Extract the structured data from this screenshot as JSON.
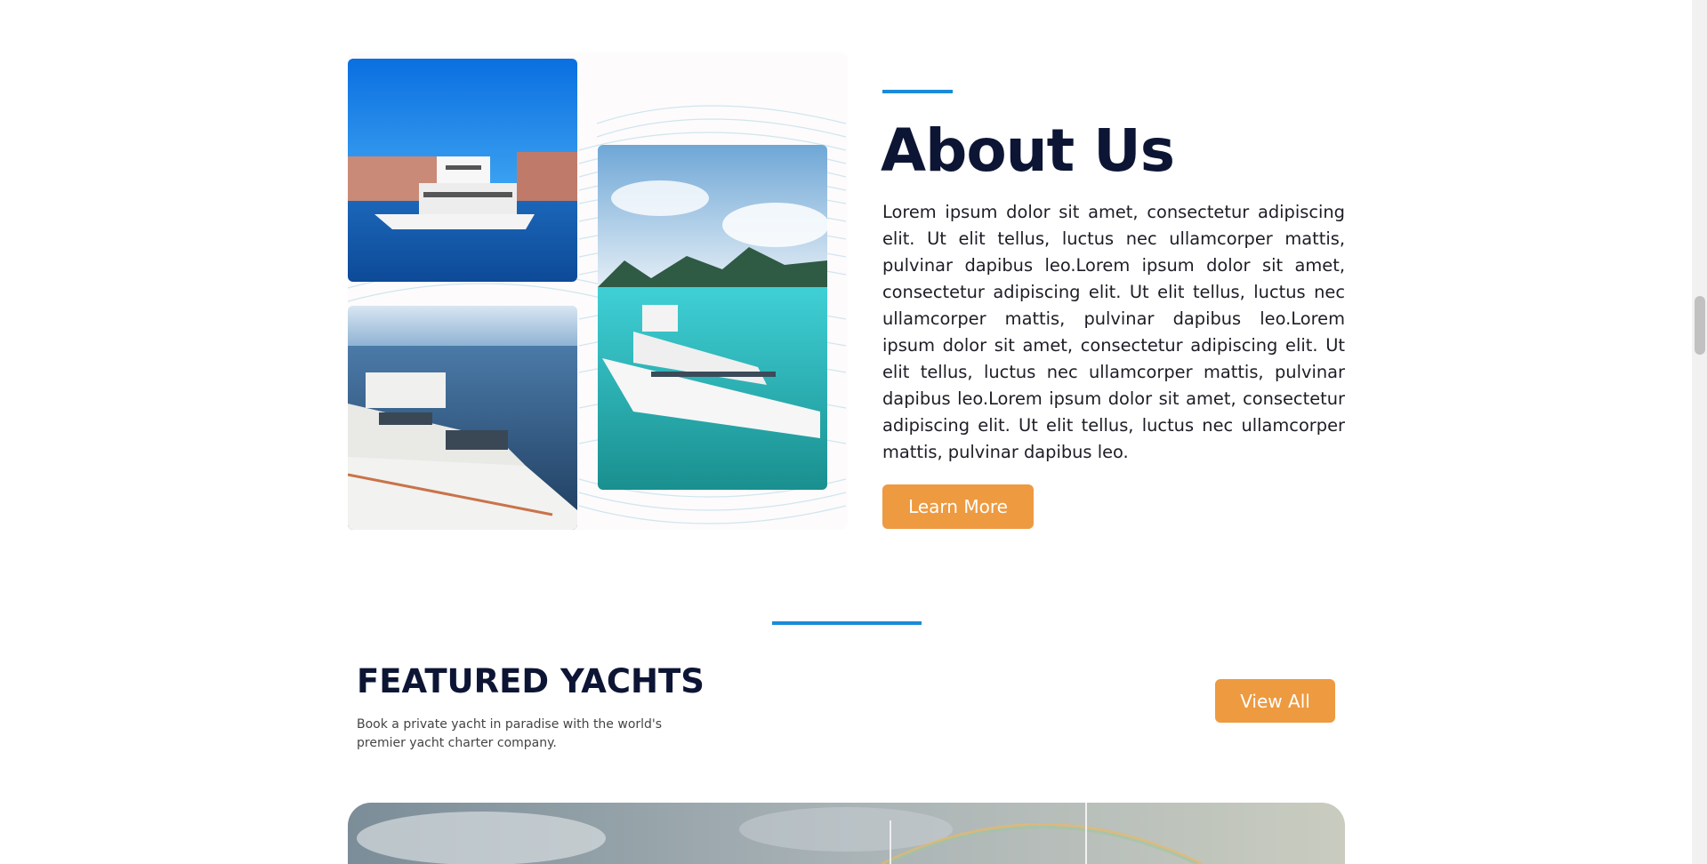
{
  "about": {
    "title": "About Us",
    "body": "Lorem ipsum dolor sit amet, consectetur adipiscing elit. Ut elit tellus, luctus nec ullamcorper mattis, pulvinar dapibus leo.Lorem ipsum dolor sit amet, consectetur adipiscing elit. Ut elit tellus, luctus nec ullamcorper mattis, pulvinar dapibus leo.Lorem ipsum dolor sit amet, consectetur adipiscing elit. Ut elit tellus, luctus nec ullamcorper mattis, pulvinar dapibus leo.Lorem ipsum dolor sit amet, consectetur adipiscing elit. Ut elit tellus, luctus nec ullamcorper mattis, pulvinar dapibus leo.",
    "button_label": "Learn More"
  },
  "featured": {
    "title": "FEATURED YACHTS",
    "subtitle": "Book a private yacht in paradise with the world's premier yacht charter company.",
    "button_label": "View All"
  },
  "colors": {
    "accent_blue": "#1a8bd8",
    "button_orange": "#ee9a40",
    "heading_navy": "#0d1535"
  }
}
